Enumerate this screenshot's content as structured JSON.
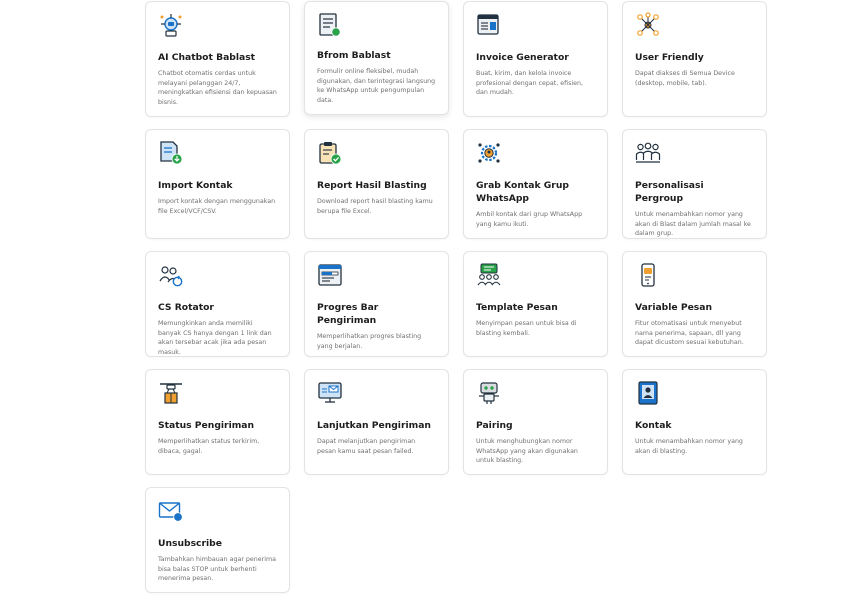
{
  "features": [
    {
      "key": "ai-chatbot",
      "icon": "chatbot-icon",
      "title": "AI Chatbot Bablast",
      "desc": "Chatbot otomatis cerdas untuk melayani pelanggan 24/7, meningkatkan efisiensi dan kepuasan bisnis."
    },
    {
      "key": "bfrom",
      "icon": "form-icon",
      "title": "Bfrom Bablast",
      "desc": "Formulir online fleksibel, mudah digunakan, dan terintegrasi langsung ke WhatsApp untuk pengumpulan data."
    },
    {
      "key": "invoice",
      "icon": "invoice-icon",
      "title": "Invoice Generator",
      "desc": "Buat, kirim, dan kelola invoice profesional dengan cepat, efisien, dan mudah."
    },
    {
      "key": "user-friendly",
      "icon": "network-users-icon",
      "title": "User Friendly",
      "desc": "Dapat diakses di Semua Device (desktop, mobile, tab)."
    },
    {
      "key": "import-kontak",
      "icon": "import-file-icon",
      "title": "Import Kontak",
      "desc": "Import kontak dengan menggunakan file Excel/VCF/CSV."
    },
    {
      "key": "report",
      "icon": "clipboard-check-icon",
      "title": "Report Hasil Blasting",
      "desc": "Download report hasil blasting kamu berupa file Excel."
    },
    {
      "key": "grab-kontak",
      "icon": "group-gear-icon",
      "title": "Grab Kontak Grup WhatsApp",
      "desc": "Ambil kontak dari grup WhatsApp yang kamu ikuti."
    },
    {
      "key": "personalisasi",
      "icon": "people-group-icon",
      "title": "Personalisasi Pergroup",
      "desc": "Untuk menambahkan nomor yang akan di Blast dalam jumlah masal ke dalam grup."
    },
    {
      "key": "cs-rotator",
      "icon": "user-rotate-icon",
      "title": "CS Rotator",
      "desc": "Memungkinkan anda memiliki banyak CS hanya dengan 1 link dan akan tersebar acak jika ada pesan masuk."
    },
    {
      "key": "progres-bar",
      "icon": "progress-window-icon",
      "title": "Progres Bar Pengiriman",
      "desc": "Memperlihatkan progres blasting yang berjalan."
    },
    {
      "key": "template",
      "icon": "template-chat-icon",
      "title": "Template Pesan",
      "desc": "Menyimpan pesan untuk bisa di blasting kembali."
    },
    {
      "key": "variable",
      "icon": "phone-message-icon",
      "title": "Variable Pesan",
      "desc": "Fitur otomatisasi untuk menyebut nama penerima, sapaan, dll yang dapat dicustom sesuai kebutuhan."
    },
    {
      "key": "status",
      "icon": "drone-package-icon",
      "title": "Status Pengiriman",
      "desc": "Memperlihatkan status terkirim, dibaca, gagal."
    },
    {
      "key": "lanjutkan",
      "icon": "monitor-mail-icon",
      "title": "Lanjutkan Pengiriman",
      "desc": "Dapat melanjutkan pengiriman pesan kamu saat pesan failed."
    },
    {
      "key": "pairing",
      "icon": "robot-pairing-icon",
      "title": "Pairing",
      "desc": "Untuk menghubungkan nomor WhatsApp yang akan digunakan untuk blasting."
    },
    {
      "key": "kontak",
      "icon": "contact-book-icon",
      "title": "Kontak",
      "desc": "Untuk menambahkan nomor yang akan di blasting."
    },
    {
      "key": "unsubscribe",
      "icon": "envelope-icon",
      "title": "Unsubscribe",
      "desc": "Tambahkan himbauan agar penerima bisa balas STOP untuk berhenti menerima pesan."
    }
  ],
  "colors": {
    "accent": "#1a73c9",
    "dark": "#22313f",
    "orange": "#f0a030",
    "green": "#2aa24a"
  }
}
